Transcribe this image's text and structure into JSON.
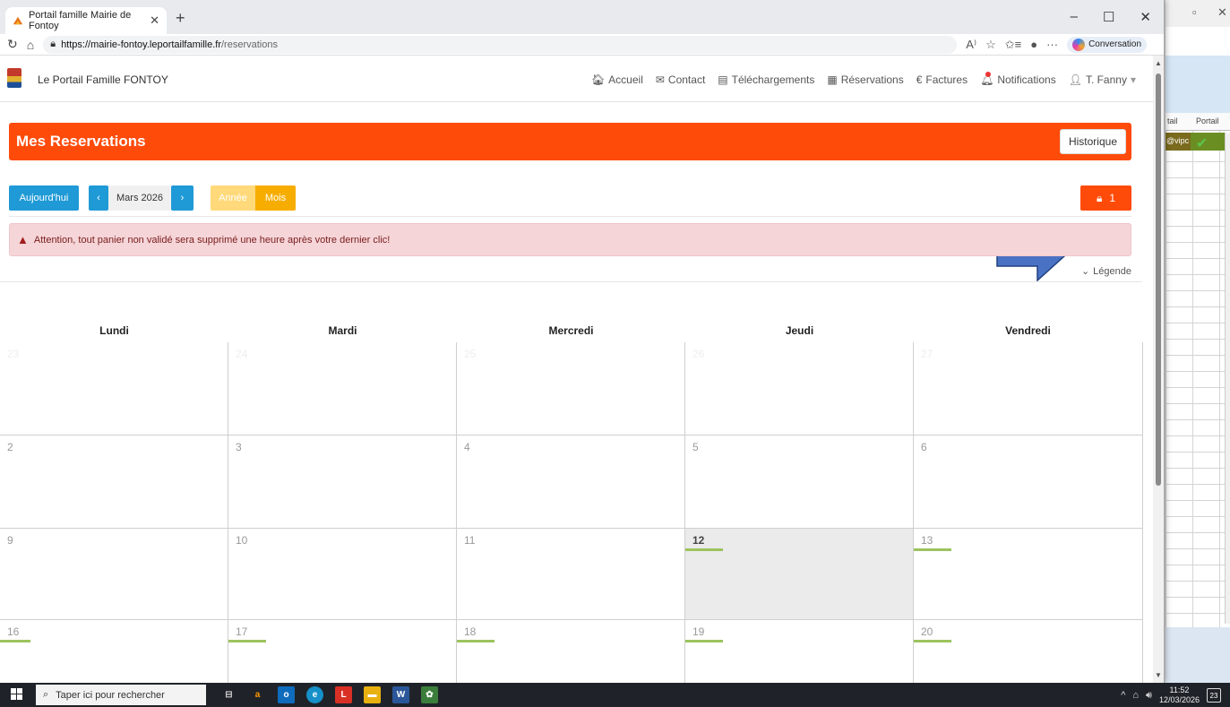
{
  "browser": {
    "tab_title": "Portail famille Mairie de Fontoy",
    "url_host": "https://mairie-fontoy.leportailfamille.fr",
    "url_path": "/reservations",
    "conversation_label": "Conversation"
  },
  "site": {
    "brand": "Le Portail Famille FONTOY",
    "menu": {
      "accueil": "Accueil",
      "contact": "Contact",
      "telechargements": "Téléchargements",
      "reservations": "Réservations",
      "factures": "Factures",
      "notifications": "Notifications",
      "user": "T. Fanny"
    },
    "page_title": "Mes Reservations",
    "historique": "Historique",
    "today_btn": "Aujourd'hui",
    "current_month": "Mars 2026",
    "view_year": "Année",
    "view_month": "Mois",
    "cart_count": "1",
    "alert_text": "Attention, tout panier non validé sera supprimé une heure après votre dernier clic!",
    "legend": "Légende",
    "day_names": [
      "Lundi",
      "Mardi",
      "Mercredi",
      "Jeudi",
      "Vendredi"
    ],
    "weeks": [
      [
        "23",
        "24",
        "25",
        "26",
        "27"
      ],
      [
        "2",
        "3",
        "4",
        "5",
        "6"
      ],
      [
        "9",
        "10",
        "11",
        "12",
        "13"
      ],
      [
        "16",
        "17",
        "18",
        "19",
        "20"
      ]
    ]
  },
  "background_excel": {
    "col_a": "tail",
    "col_b": "Portail",
    "cell": "@vipc"
  },
  "taskbar": {
    "search_placeholder": "Taper ici pour rechercher",
    "time": "11:52",
    "date": "12/03/2026",
    "notif_count": "23"
  },
  "colors": {
    "accent_orange": "#ff4b0a",
    "accent_blue": "#1f9ad6",
    "accent_yellow": "#f7ad00",
    "availability_green": "#9cc45e"
  }
}
